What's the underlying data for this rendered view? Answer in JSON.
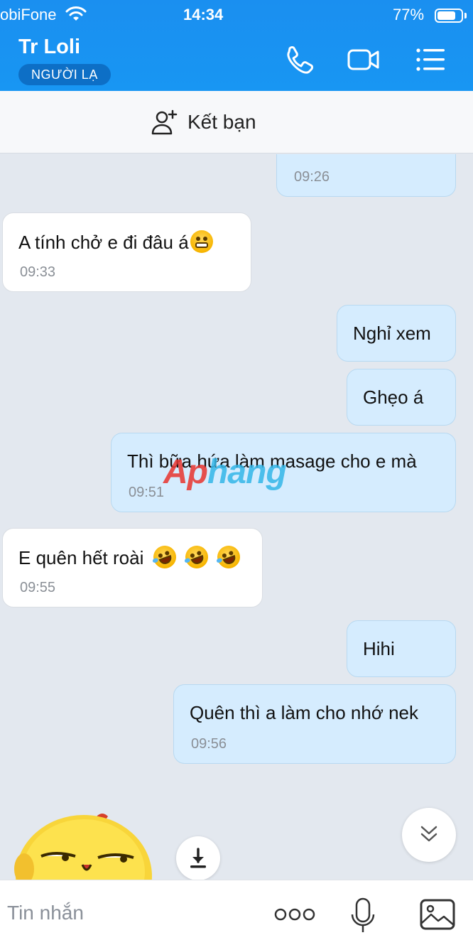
{
  "status_bar": {
    "carrier": "obiFone",
    "time": "14:34",
    "battery": "77%",
    "battery_level": 0.77
  },
  "header": {
    "name": "Tr Loli",
    "badge": "NGƯỜI LẠ"
  },
  "add_friend": {
    "label": "Kết bạn"
  },
  "messages": [
    {
      "dir": "out",
      "text": "",
      "time": "09:26"
    },
    {
      "dir": "in",
      "text": "A tính chở e đi đâu á",
      "time": "09:33"
    },
    {
      "dir": "out",
      "text": "Nghỉ xem",
      "time": ""
    },
    {
      "dir": "out",
      "text": "Ghẹo á",
      "time": ""
    },
    {
      "dir": "out",
      "text": "Thì bữa hứa làm masage cho e mà",
      "time": "09:51"
    },
    {
      "dir": "in",
      "text": "E quên hết roài",
      "time": "09:55"
    },
    {
      "dir": "out",
      "text": "Hihi",
      "time": ""
    },
    {
      "dir": "out",
      "text": "Quên thì a làm cho nhớ nek",
      "time": "09:56"
    }
  ],
  "watermark": {
    "part1": "Ap",
    "part2": "hang"
  },
  "composer": {
    "placeholder": "Tin nhắn"
  },
  "icons": {
    "call": "phone-icon",
    "video": "video-camera-icon",
    "menu": "list-menu-icon",
    "add_friend": "add-user-icon",
    "more": "more-dots-icon",
    "mic": "microphone-icon",
    "image": "image-icon",
    "download": "download-icon",
    "scroll": "chevron-double-down-icon"
  }
}
